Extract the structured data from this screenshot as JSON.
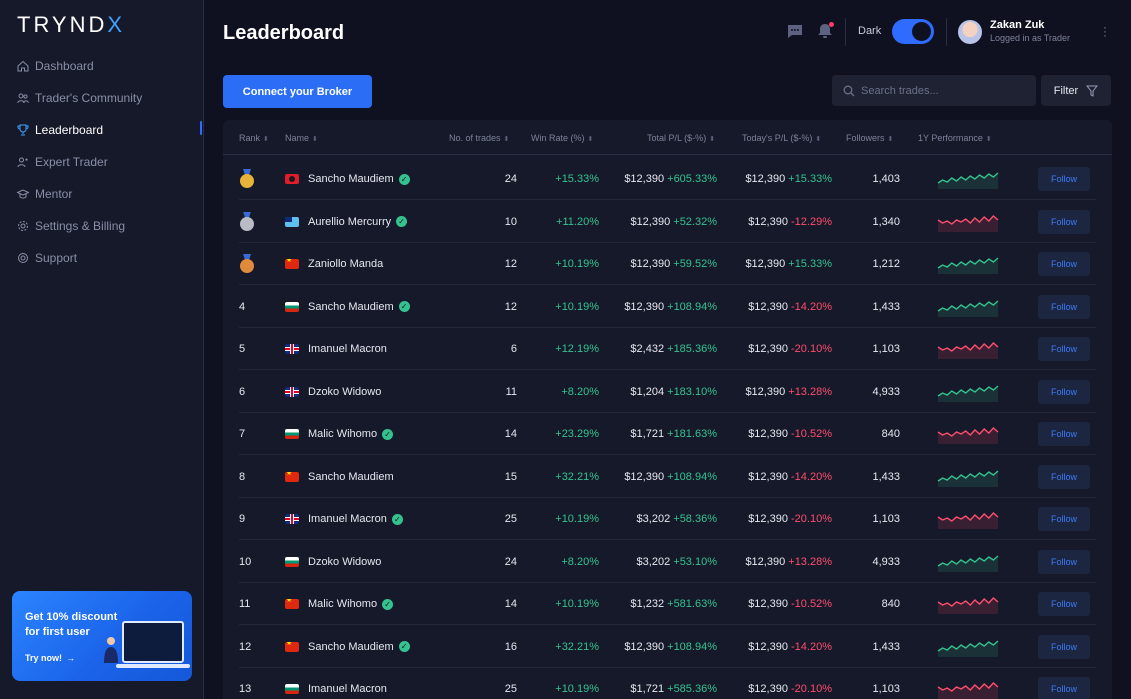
{
  "app": {
    "logo": "TRYNDX"
  },
  "sidebar": {
    "items": [
      {
        "label": "Dashboard",
        "icon": "home-icon",
        "active": false
      },
      {
        "label": "Trader's Community",
        "icon": "users-icon",
        "active": false
      },
      {
        "label": "Leaderboard",
        "icon": "trophy-icon",
        "active": true
      },
      {
        "label": "Expert Trader",
        "icon": "user-star-icon",
        "active": false
      },
      {
        "label": "Mentor",
        "icon": "graduation-cap-icon",
        "active": false
      },
      {
        "label": "Settings & Billing",
        "icon": "gear-icon",
        "active": false
      },
      {
        "label": "Support",
        "icon": "lifebuoy-icon",
        "active": false
      }
    ],
    "promo": {
      "title": "Get 10% discount for first user",
      "cta": "Try now!"
    }
  },
  "header": {
    "title": "Leaderboard",
    "theme_label": "Dark",
    "user": {
      "name": "Zakan Zuk",
      "role": "Logged in as Trader"
    }
  },
  "actions": {
    "broker_button": "Connect your Broker",
    "search_placeholder": "Search trades...",
    "filter_label": "Filter"
  },
  "table": {
    "columns": [
      "Rank",
      "Name",
      "No. of trades",
      "Win Rate (%)",
      "Total P/L ($-%)",
      "Today's P/L ($-%)",
      "Followers",
      "1Y Performance"
    ],
    "follow_label": "Follow",
    "rows": [
      {
        "rank": "1",
        "medal": "gold",
        "flag": "al",
        "name": "Sancho Maudiem",
        "verified": true,
        "trades": "24",
        "win_rate": "+15.33%",
        "total_amt": "$12,390",
        "total_pct": "+605.33%",
        "today_amt": "$12,390",
        "today_pct": "+15.33%",
        "today_up": true,
        "followers": "1,403",
        "trend": "up"
      },
      {
        "rank": "2",
        "medal": "silver",
        "flag": "tv",
        "name": "Aurellio Mercurry",
        "verified": true,
        "trades": "10",
        "win_rate": "+11.20%",
        "total_amt": "$12,390",
        "total_pct": "+52.32%",
        "today_amt": "$12,390",
        "today_pct": "-12.29%",
        "today_up": false,
        "followers": "1,340",
        "trend": "down"
      },
      {
        "rank": "3",
        "medal": "bronze",
        "flag": "cn",
        "name": "Zaniollo Manda",
        "verified": false,
        "trades": "12",
        "win_rate": "+10.19%",
        "total_amt": "$12,390",
        "total_pct": "+59.52%",
        "today_amt": "$12,390",
        "today_pct": "+15.33%",
        "today_up": true,
        "followers": "1,212",
        "trend": "up"
      },
      {
        "rank": "4",
        "medal": "",
        "flag": "bg",
        "name": "Sancho Maudiem",
        "verified": true,
        "trades": "12",
        "win_rate": "+10.19%",
        "total_amt": "$12,390",
        "total_pct": "+108.94%",
        "today_amt": "$12,390",
        "today_pct": "-14.20%",
        "today_up": false,
        "followers": "1,433",
        "trend": "up"
      },
      {
        "rank": "5",
        "medal": "",
        "flag": "gb",
        "name": "Imanuel Macron",
        "verified": false,
        "trades": "6",
        "win_rate": "+12.19%",
        "total_amt": "$2,432",
        "total_pct": "+185.36%",
        "today_amt": "$12,390",
        "today_pct": "-20.10%",
        "today_up": false,
        "followers": "1,103",
        "trend": "down"
      },
      {
        "rank": "6",
        "medal": "",
        "flag": "gb",
        "name": "Dzoko Widowo",
        "verified": false,
        "trades": "11",
        "win_rate": "+8.20%",
        "total_amt": "$1,204",
        "total_pct": "+183.10%",
        "today_amt": "$12,390",
        "today_pct": "+13.28%",
        "today_up": false,
        "followers": "4,933",
        "trend": "up"
      },
      {
        "rank": "7",
        "medal": "",
        "flag": "bg",
        "name": "Malic Wihomo",
        "verified": true,
        "trades": "14",
        "win_rate": "+23.29%",
        "total_amt": "$1,721",
        "total_pct": "+181.63%",
        "today_amt": "$12,390",
        "today_pct": "-10.52%",
        "today_up": false,
        "followers": "840",
        "trend": "down"
      },
      {
        "rank": "8",
        "medal": "",
        "flag": "cn",
        "name": "Sancho Maudiem",
        "verified": false,
        "trades": "15",
        "win_rate": "+32.21%",
        "total_amt": "$12,390",
        "total_pct": "+108.94%",
        "today_amt": "$12,390",
        "today_pct": "-14.20%",
        "today_up": false,
        "followers": "1,433",
        "trend": "up"
      },
      {
        "rank": "9",
        "medal": "",
        "flag": "gb",
        "name": "Imanuel Macron",
        "verified": true,
        "trades": "25",
        "win_rate": "+10.19%",
        "total_amt": "$3,202",
        "total_pct": "+58.36%",
        "today_amt": "$12,390",
        "today_pct": "-20.10%",
        "today_up": false,
        "followers": "1,103",
        "trend": "down"
      },
      {
        "rank": "10",
        "medal": "",
        "flag": "bg",
        "name": "Dzoko Widowo",
        "verified": false,
        "trades": "24",
        "win_rate": "+8.20%",
        "total_amt": "$3,202",
        "total_pct": "+53.10%",
        "today_amt": "$12,390",
        "today_pct": "+13.28%",
        "today_up": false,
        "followers": "4,933",
        "trend": "up"
      },
      {
        "rank": "11",
        "medal": "",
        "flag": "cn",
        "name": "Malic Wihomo",
        "verified": true,
        "trades": "14",
        "win_rate": "+10.19%",
        "total_amt": "$1,232",
        "total_pct": "+581.63%",
        "today_amt": "$12,390",
        "today_pct": "-10.52%",
        "today_up": false,
        "followers": "840",
        "trend": "down"
      },
      {
        "rank": "12",
        "medal": "",
        "flag": "cn",
        "name": "Sancho Maudiem",
        "verified": true,
        "trades": "16",
        "win_rate": "+32.21%",
        "total_amt": "$12,390",
        "total_pct": "+108.94%",
        "today_amt": "$12,390",
        "today_pct": "-14.20%",
        "today_up": false,
        "followers": "1,433",
        "trend": "up"
      },
      {
        "rank": "13",
        "medal": "",
        "flag": "bg",
        "name": "Imanuel Macron",
        "verified": false,
        "trades": "25",
        "win_rate": "+10.19%",
        "total_amt": "$1,721",
        "total_pct": "+585.36%",
        "today_amt": "$12,390",
        "today_pct": "-20.10%",
        "today_up": false,
        "followers": "1,103",
        "trend": "down"
      }
    ]
  },
  "colors": {
    "accent": "#2b6ef5",
    "positive": "#34c38f",
    "negative": "#ff4d6d",
    "background": "#0f1120",
    "panel": "#161929"
  }
}
